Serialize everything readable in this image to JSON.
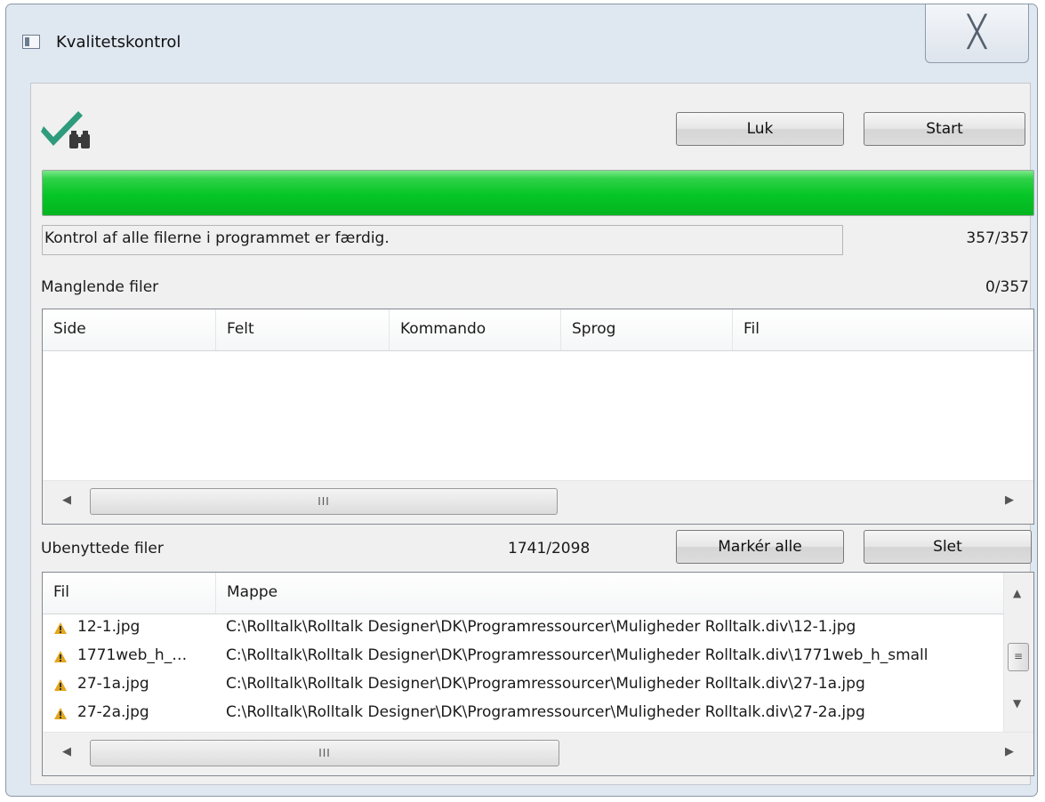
{
  "window": {
    "title": "Kvalitetskontrol"
  },
  "toolbar": {
    "close_label": "Luk",
    "start_label": "Start"
  },
  "progress": {
    "fraction": 1.0,
    "fill_color": "#05c626"
  },
  "status": {
    "message": "Kontrol af alle filerne i programmet er færdig.",
    "count": "357/357"
  },
  "missing": {
    "title": "Manglende filer",
    "count": "0/357",
    "columns": [
      "Side",
      "Felt",
      "Kommando",
      "Sprog",
      "Fil"
    ]
  },
  "unused": {
    "title": "Ubenyttede filer",
    "count": "1741/2098",
    "select_all_label": "Markér alle",
    "delete_label": "Slet",
    "columns": [
      "Fil",
      "Mappe"
    ],
    "rows": [
      {
        "file": "12-1.jpg",
        "folder": "C:\\Rolltalk\\Rolltalk Designer\\DK\\Programressourcer\\Muligheder Rolltalk.div\\12-1.jpg"
      },
      {
        "file": "1771web_h_…",
        "folder": "C:\\Rolltalk\\Rolltalk Designer\\DK\\Programressourcer\\Muligheder Rolltalk.div\\1771web_h_small"
      },
      {
        "file": "27-1a.jpg",
        "folder": "C:\\Rolltalk\\Rolltalk Designer\\DK\\Programressourcer\\Muligheder Rolltalk.div\\27-1a.jpg"
      },
      {
        "file": "27-2a.jpg",
        "folder": "C:\\Rolltalk\\Rolltalk Designer\\DK\\Programressourcer\\Muligheder Rolltalk.div\\27-2a.jpg"
      }
    ]
  },
  "icons": {
    "app": "check-binoculars-icon",
    "close": "close-x-icon",
    "row_warning": "warning-icon",
    "check_color": "#2e9c7c"
  }
}
